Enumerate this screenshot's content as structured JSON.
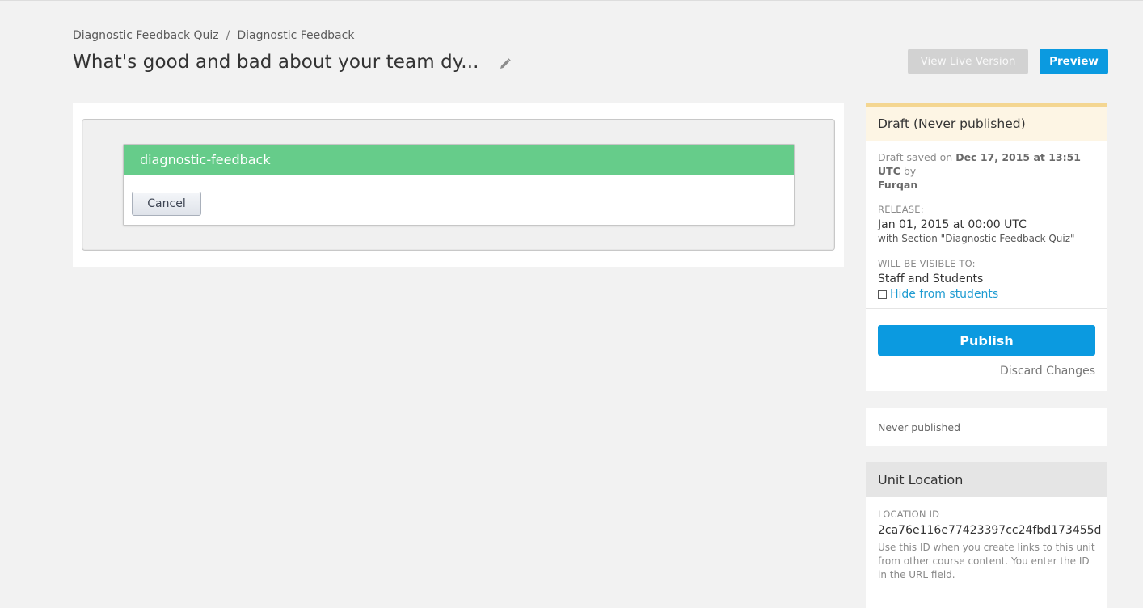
{
  "breadcrumb": {
    "items": [
      "Diagnostic Feedback Quiz",
      "Diagnostic Feedback"
    ],
    "separator": "/"
  },
  "page": {
    "title": "What's good and bad about your team dy...",
    "edit_icon": "pencil-icon"
  },
  "actions": {
    "view_live_label": "View Live Version",
    "preview_label": "Preview"
  },
  "xblock": {
    "header": "diagnostic-feedback",
    "cancel_label": "Cancel"
  },
  "publish_status": {
    "title": "Draft (Never published)",
    "draft_prefix": "Draft saved on ",
    "draft_date": "Dec 17, 2015 at 13:51 UTC",
    "draft_by": " by",
    "draft_user": "Furqan",
    "release_label": "RELEASE:",
    "release_date": "Jan 01, 2015 at 00:00 UTC",
    "release_section": "with Section \"Diagnostic Feedback Quiz\"",
    "visible_label": "WILL BE VISIBLE TO:",
    "visible_value": "Staff and Students",
    "hide_label": "Hide from students",
    "publish_label": "Publish",
    "discard_label": "Discard Changes"
  },
  "never_published": "Never published",
  "unit_location": {
    "title": "Unit Location",
    "id_label": "LOCATION ID",
    "id_value": "2ca76e116e77423397cc24fbd173455d",
    "help": "Use this ID when you create links to this unit from other course content. You enter the ID in the URL field."
  },
  "colors": {
    "primary": "#0b9ae0",
    "xblock_header": "#66cc8a",
    "draft_accent": "#f4d691",
    "link": "#1d9bd1"
  }
}
